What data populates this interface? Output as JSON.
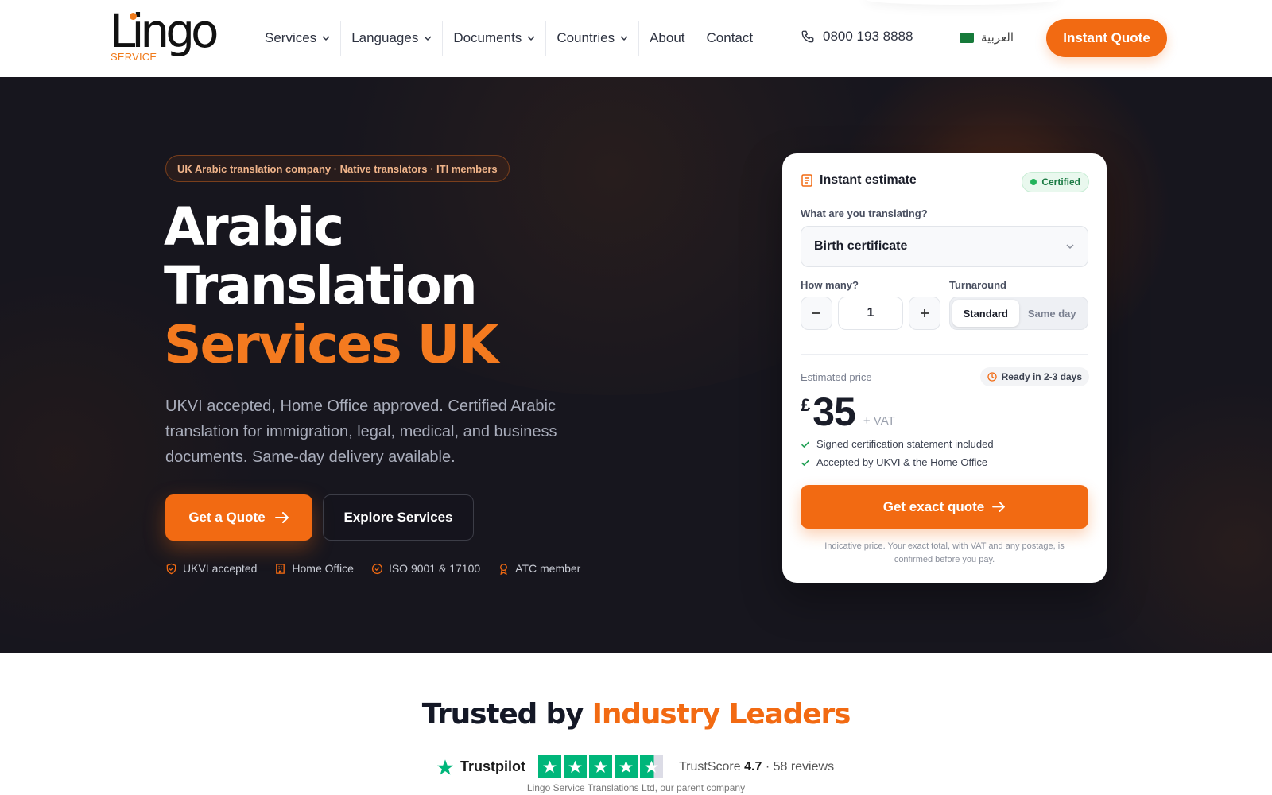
{
  "header": {
    "logo_word": "Lingo",
    "logo_sub": "SERVICE",
    "nav": [
      {
        "label": "Services",
        "has_dropdown": true
      },
      {
        "label": "Languages",
        "has_dropdown": true
      },
      {
        "label": "Documents",
        "has_dropdown": true
      },
      {
        "label": "Countries",
        "has_dropdown": true
      },
      {
        "label": "About",
        "has_dropdown": false
      },
      {
        "label": "Contact",
        "has_dropdown": false
      }
    ],
    "phone": "0800 193 8888",
    "lang_label": "العربية",
    "cta": "Instant Quote"
  },
  "hero": {
    "pill": "UK Arabic translation company · Native translators · ITI members",
    "title_line1": "Arabic",
    "title_line2": "Translation",
    "title_line3": "Services UK",
    "subtitle": "UKVI accepted, Home Office approved. Certified Arabic translation for immigration, legal, medical, and business documents. Same-day delivery available.",
    "primary_button": "Get a Quote",
    "secondary_button": "Explore Services",
    "badges": [
      {
        "label": "UKVI accepted",
        "icon": "shield-check-icon"
      },
      {
        "label": "Home Office",
        "icon": "building-icon"
      },
      {
        "label": "ISO 9001 & 17100",
        "icon": "circle-check-icon"
      },
      {
        "label": "ATC member",
        "icon": "award-icon"
      }
    ]
  },
  "estimate": {
    "title": "Instant estimate",
    "certified": "Certified",
    "doc_label": "What are you translating?",
    "doc_value": "Birth certificate",
    "qty_label": "How many?",
    "qty_value": "1",
    "turnaround_label": "Turnaround",
    "turnaround_options": [
      "Standard",
      "Same day"
    ],
    "turnaround_selected": "Standard",
    "price_label": "Estimated price",
    "ready": "Ready in 2-3 days",
    "currency": "£",
    "price": "35",
    "vat": "+ VAT",
    "checks": [
      "Signed certification statement included",
      "Accepted by UKVI & the Home Office"
    ],
    "button": "Get exact quote",
    "disclaimer": "Indicative price. Your exact total, with VAT and any postage, is confirmed before you pay."
  },
  "trusted": {
    "title_a": "Trusted by",
    "title_b": "Industry Leaders",
    "brand": "Trustpilot",
    "rating": 4.7,
    "score_label": "TrustScore",
    "score": "4.7",
    "reviews": "· 58 reviews",
    "parent": "Lingo Service Translations Ltd, our parent company"
  },
  "colors": {
    "accent": "#f26a12",
    "hero_bg": "#17161e",
    "trustpilot_green": "#00b67a"
  }
}
